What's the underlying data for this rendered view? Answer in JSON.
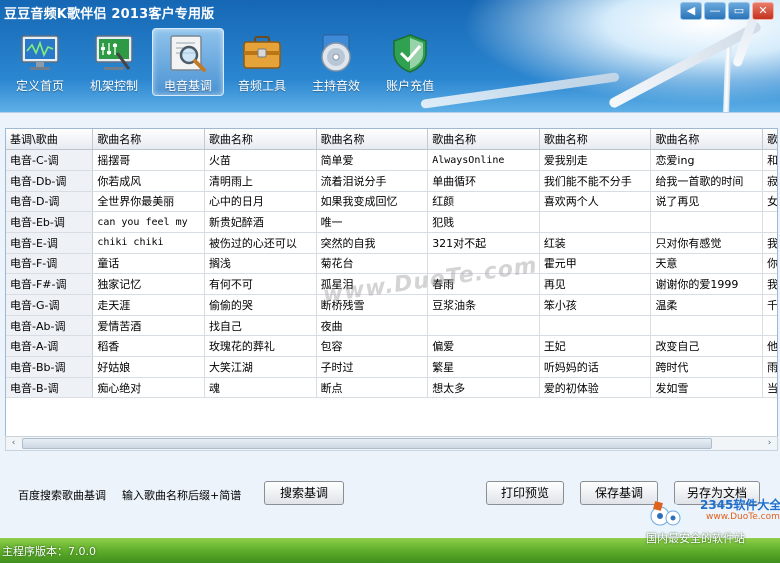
{
  "window": {
    "title": "豆豆音频K歌伴侣 2013客户专用版",
    "controls": [
      "◀",
      "—",
      "▭",
      "✕"
    ]
  },
  "toolbar": [
    {
      "label": "定义首页",
      "icon": "monitor-icon"
    },
    {
      "label": "机架控制",
      "icon": "rack-control-icon"
    },
    {
      "label": "电音基调",
      "icon": "search-music-icon",
      "active": true
    },
    {
      "label": "音频工具",
      "icon": "toolbox-icon"
    },
    {
      "label": "主持音效",
      "icon": "cd-icon"
    },
    {
      "label": "账户充值",
      "icon": "shield-icon"
    }
  ],
  "table": {
    "headers": [
      "基调\\歌曲",
      "歌曲名称",
      "歌曲名称",
      "歌曲名称",
      "歌曲名称",
      "歌曲名称",
      "歌曲名称",
      "歌曲名称"
    ],
    "rows": [
      [
        "电音-C-调",
        "摇摆哥",
        "火苗",
        "简单爱",
        "AlwaysOnline",
        "爱我别走",
        "恋爱ing",
        "和平分手"
      ],
      [
        "电音-Db-调",
        "你若成风",
        "清明雨上",
        "流着泪说分手",
        "单曲循环",
        "我们能不能不分手",
        "给我一首歌的时间",
        "寂寞的季节"
      ],
      [
        "电音-D-调",
        "全世界你最美丽",
        "心中的日月",
        "如果我变成回忆",
        "红颜",
        "喜欢两个人",
        "说了再见",
        "女人不该让男人太累"
      ],
      [
        "电音-Eb-调",
        "can you feel my",
        "新贵妃醉酒",
        "唯一",
        "犯贱",
        "",
        "",
        ""
      ],
      [
        "电音-E-调",
        "chiki chiki",
        "被伤过的心还可以",
        "突然的自我",
        "321对不起",
        "红装",
        "只对你有感觉",
        "我会很诚实"
      ],
      [
        "电音-F-调",
        "童话",
        "搁浅",
        "菊花台",
        "",
        "霍元甲",
        "天意",
        "你吧我灌醉"
      ],
      [
        "电音-F#-调",
        "独家记忆",
        "有何不可",
        "孤星泪",
        "春雨",
        "再见",
        "谢谢你的爱1999",
        "我们的歌"
      ],
      [
        "电音-G-调",
        "走天涯",
        "偷偷的哭",
        "断桥残雪",
        "豆浆油条",
        "笨小孩",
        "温柔",
        "千纸鹤"
      ],
      [
        "电音-Ab-调",
        "爱情苦酒",
        "找自己",
        "夜曲",
        "",
        "",
        "",
        ""
      ],
      [
        "电音-A-调",
        "稻香",
        "玫瑰花的葬礼",
        "包容",
        "偏爱",
        "王妃",
        "改变自己",
        "他一定很爱你"
      ],
      [
        "电音-Bb-调",
        "好姑娘",
        "大笑江湖",
        "子时过",
        "繁星",
        "听妈妈的话",
        "跨时代",
        "雨下一整晚"
      ],
      [
        "电音-B-调",
        "痴心绝对",
        "魂",
        "断点",
        "想太多",
        "爱的初体验",
        "发如雪",
        "当你孤单你会想起谁"
      ]
    ]
  },
  "scrollbar": {
    "left_arrow": "‹",
    "right_arrow": "›"
  },
  "search": {
    "label": "百度搜索歌曲基调",
    "hint": "输入歌曲名称后缀+简谱",
    "button": "搜索基调"
  },
  "actions": {
    "print_preview": "打印预览",
    "save": "保存基调",
    "save_as": "另存为文档"
  },
  "footer": {
    "version": "主程序版本：7.0.0"
  },
  "watermark": {
    "text": "www.DuoTe.com",
    "brand": "2345软件大全",
    "url": "www.DuoTe.com",
    "slogan": "国内最安全的软件站"
  },
  "colors": {
    "title_bar": "#1567b4",
    "active_tab": "#4b93d3",
    "footer_grass": "#5fae2b"
  }
}
